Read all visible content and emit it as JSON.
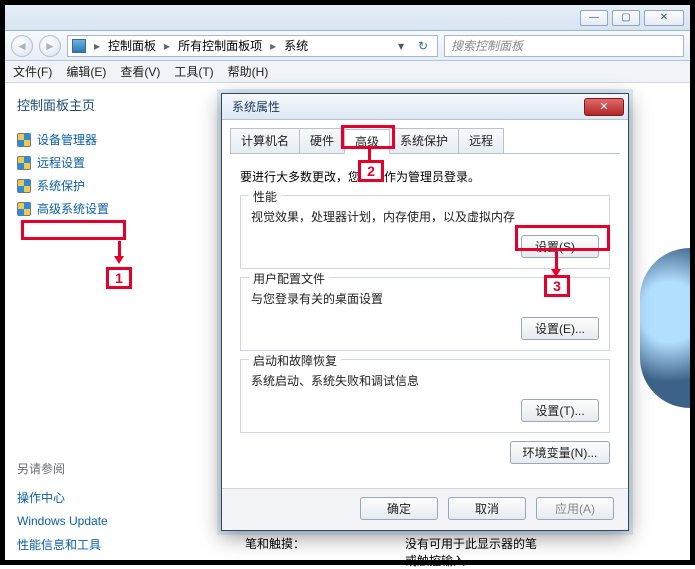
{
  "titlebar": {
    "min": "—",
    "max": "▢",
    "close": "✕"
  },
  "nav": {
    "crumb1": "控制面板",
    "crumb2": "所有控制面板项",
    "crumb3": "系统",
    "search_placeholder": "搜索控制面板"
  },
  "menu": {
    "file": "文件(F)",
    "edit": "编辑(E)",
    "view": "查看(V)",
    "tools": "工具(T)",
    "help": "帮助(H)"
  },
  "sidebar": {
    "home": "控制面板主页",
    "items": [
      "设备管理器",
      "远程设置",
      "系统保护",
      "高级系统设置"
    ],
    "see_also": "另请参阅",
    "links": [
      "操作中心",
      "Windows Update",
      "性能信息和工具"
    ]
  },
  "dialog": {
    "title": "系统属性",
    "tabs": [
      "计算机名",
      "硬件",
      "高级",
      "系统保护",
      "远程"
    ],
    "note": "要进行大多数更改，您必须作为管理员登录。",
    "groups": {
      "perf": {
        "title": "性能",
        "desc": "视觉效果，处理器计划，内存使用，以及虚拟内存",
        "btn": "设置(S)..."
      },
      "profile": {
        "title": "用户配置文件",
        "desc": "与您登录有关的桌面设置",
        "btn": "设置(E)..."
      },
      "startup": {
        "title": "启动和故障恢复",
        "desc": "系统启动、系统失败和调试信息",
        "btn": "设置(T)..."
      }
    },
    "env_btn": "环境变量(N)...",
    "ok": "确定",
    "cancel": "取消",
    "apply": "应用(A)"
  },
  "peek": {
    "label": "笔和触摸：",
    "value1": "没有可用于此显示器的笔",
    "value2": "或触控输入"
  },
  "callouts": {
    "c1": "1",
    "c2": "2",
    "c3": "3"
  }
}
